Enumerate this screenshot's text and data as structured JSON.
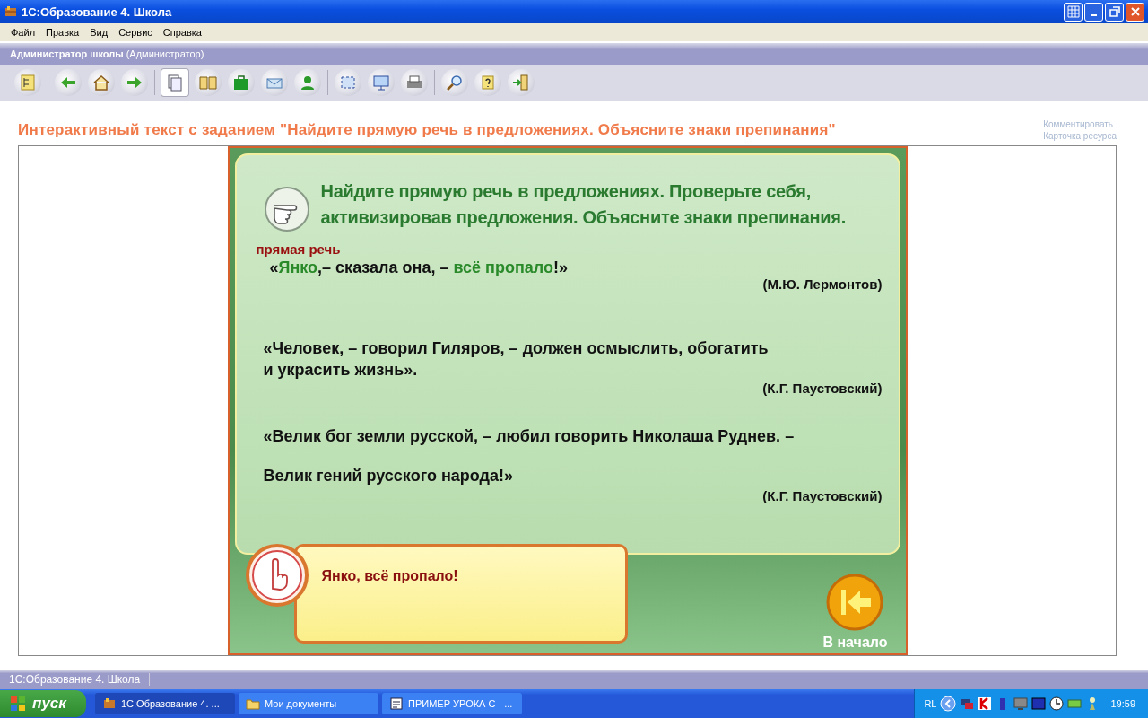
{
  "window": {
    "title": "1С:Образование 4. Школа"
  },
  "menu": [
    "Файл",
    "Правка",
    "Вид",
    "Сервис",
    "Справка"
  ],
  "user_bar": {
    "name": "Администратор школы",
    "role": "(Администратор)"
  },
  "toolbar": [
    [
      {
        "selected": false
      }
    ],
    [
      {
        "selected": false
      },
      {
        "selected": false
      },
      {
        "selected": false
      }
    ],
    [
      {
        "selected": true
      },
      {
        "selected": false
      },
      {
        "selected": false
      },
      {
        "selected": false
      },
      {
        "selected": false
      }
    ],
    [
      {
        "selected": false
      },
      {
        "selected": false
      },
      {
        "selected": false
      }
    ],
    [
      {
        "selected": false
      },
      {
        "selected": false
      },
      {
        "selected": false
      }
    ]
  ],
  "heading": "Интерактивный текст с заданием \"Найдите прямую речь в предложениях. Объясните знаки препинания\"",
  "side_links": [
    "Комментировать",
    "Карточка ресурса"
  ],
  "activity": {
    "task": "Найдите прямую речь в предложениях. Проверьте себя,\nактивизировав предложения. Объясните знаки препинания.",
    "label": "прямая речь",
    "quotes": [
      {
        "parts": [
          {
            "text": "«",
            "highlight": false
          },
          {
            "text": "Янко",
            "highlight": true
          },
          {
            "text": ",– сказала она, – ",
            "highlight": false
          },
          {
            "text": "всё пропало",
            "highlight": true
          },
          {
            "text": "!»",
            "highlight": false
          }
        ],
        "author": "(М.Ю. Лермонтов)"
      },
      {
        "parts": [
          {
            "text": "«Человек, – говорил Гиляров, – должен осмыслить, обогатить\nи украсить жизнь».",
            "highlight": false
          }
        ],
        "author": "(К.Г. Паустовский)"
      },
      {
        "parts": [
          {
            "text": "«Велик бог земли русской, – любил говорить Николаша Руднев. –\nВелик гений русского народа!»",
            "highlight": false
          }
        ],
        "author": "(К.Г. Паустовский)"
      }
    ],
    "hint": "Янко, всё пропало!",
    "home_button": "В начало"
  },
  "status_bar": "1С:Образование 4. Школа",
  "taskbar": {
    "start": "пуск",
    "tasks": [
      {
        "label": "1С:Образование 4. ...",
        "selected": true
      },
      {
        "label": "Мои документы",
        "selected": false
      },
      {
        "label": "ПРИМЕР УРОКА С - ...",
        "selected": false
      }
    ],
    "language": "RL",
    "time": "19:59"
  }
}
